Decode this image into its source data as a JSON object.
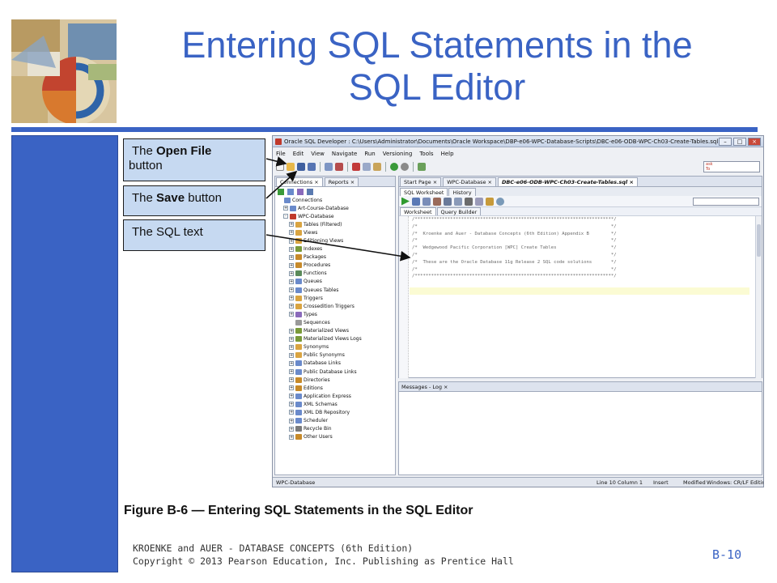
{
  "slide": {
    "title_line1": "Entering SQL Statements in the",
    "title_line2": "SQL Editor",
    "caption": "Figure B-6 — Entering SQL Statements in the SQL Editor",
    "footer_line1": "KROENKE and AUER - DATABASE CONCEPTS (6th Edition)",
    "footer_line2": "Copyright © 2013 Pearson Education, Inc. Publishing as Prentice Hall",
    "page_number": "B-10",
    "accent_color": "#3a63c4"
  },
  "callouts": [
    {
      "prefix": "The ",
      "bold": "Open File",
      "suffix": " button"
    },
    {
      "prefix": "The ",
      "bold": "Save",
      "suffix": " button"
    },
    {
      "prefix": "The SQL text",
      "bold": "",
      "suffix": ""
    }
  ],
  "window": {
    "title": "Oracle SQL Developer : C:\\Users\\Administrator\\Documents\\Oracle Workspace\\DBP-e06-WPC-Database-Scripts\\DBC-e06-ODB-WPC-Ch03-Create-Tables.sql",
    "menu": [
      "File",
      "Edit",
      "View",
      "Navigate",
      "Run",
      "Versioning",
      "Tools",
      "Help"
    ],
    "search_hint": "ask\nTo",
    "toolbar_icons": [
      "new-file-icon",
      "open-file-icon",
      "save-icon",
      "save-all-icon",
      "undo-icon",
      "redo-icon",
      "cut-icon",
      "copy-icon",
      "paste-icon",
      "run-icon",
      "debug-icon",
      "migrate-icon"
    ],
    "left_tabs": [
      "Connections",
      "Reports"
    ],
    "tree": [
      {
        "label": "Connections",
        "level": 0,
        "exp": ""
      },
      {
        "label": "Art-Course-Database",
        "level": 1,
        "exp": "+"
      },
      {
        "label": "WPC-Database",
        "level": 1,
        "exp": "-"
      },
      {
        "label": "Tables (Filtered)",
        "level": 2,
        "exp": "+"
      },
      {
        "label": "Views",
        "level": 2,
        "exp": "+"
      },
      {
        "label": "Editioning Views",
        "level": 2,
        "exp": "+"
      },
      {
        "label": "Indexes",
        "level": 2,
        "exp": "+"
      },
      {
        "label": "Packages",
        "level": 2,
        "exp": "+"
      },
      {
        "label": "Procedures",
        "level": 2,
        "exp": "+"
      },
      {
        "label": "Functions",
        "level": 2,
        "exp": "+"
      },
      {
        "label": "Queues",
        "level": 2,
        "exp": "+"
      },
      {
        "label": "Queues Tables",
        "level": 2,
        "exp": "+"
      },
      {
        "label": "Triggers",
        "level": 2,
        "exp": "+"
      },
      {
        "label": "Crossedition Triggers",
        "level": 2,
        "exp": "+"
      },
      {
        "label": "Types",
        "level": 2,
        "exp": "+"
      },
      {
        "label": "Sequences",
        "level": 2,
        "exp": ""
      },
      {
        "label": "Materialized Views",
        "level": 2,
        "exp": "+"
      },
      {
        "label": "Materialized Views Logs",
        "level": 2,
        "exp": "+"
      },
      {
        "label": "Synonyms",
        "level": 2,
        "exp": "+"
      },
      {
        "label": "Public Synonyms",
        "level": 2,
        "exp": "+"
      },
      {
        "label": "Database Links",
        "level": 2,
        "exp": "+"
      },
      {
        "label": "Public Database Links",
        "level": 2,
        "exp": "+"
      },
      {
        "label": "Directories",
        "level": 2,
        "exp": "+"
      },
      {
        "label": "Editions",
        "level": 2,
        "exp": "+"
      },
      {
        "label": "Application Express",
        "level": 2,
        "exp": "+"
      },
      {
        "label": "XML Schemas",
        "level": 2,
        "exp": "+"
      },
      {
        "label": "XML DB Repository",
        "level": 2,
        "exp": "+"
      },
      {
        "label": "Scheduler",
        "level": 2,
        "exp": "+"
      },
      {
        "label": "Recycle Bin",
        "level": 2,
        "exp": "+"
      },
      {
        "label": "Other Users",
        "level": 2,
        "exp": "+"
      }
    ],
    "editor_tabs": [
      "Start Page",
      "WPC-Database",
      "DBC-e06-ODB-WPC-Ch03-Create-Tables.sql"
    ],
    "editor_subtabs": [
      "SQL Worksheet",
      "History"
    ],
    "worksheet_tabs": [
      "Worksheet",
      "Query Builder"
    ],
    "code_lines": [
      "/*************************************************************************/",
      "/*                                                                       */",
      "/*  Kroenke and Auer - Database Concepts (6th Edition) Appendix B        */",
      "/*                                                                       */",
      "/*  Wedgewood Pacific Corporation [WPC] Create Tables                    */",
      "/*                                                                       */",
      "/*  These are the Oracle Database 11g Release 2 SQL code solutions       */",
      "/*                                                                       */",
      "/*************************************************************************/",
      ""
    ],
    "messages_tab": "Messages - Log",
    "status": {
      "connection": "WPC-Database",
      "position": "Line 10 Column 1",
      "mode": "Insert",
      "modified": "Modified",
      "line_endings": "Windows: CR/LF Editing"
    }
  }
}
